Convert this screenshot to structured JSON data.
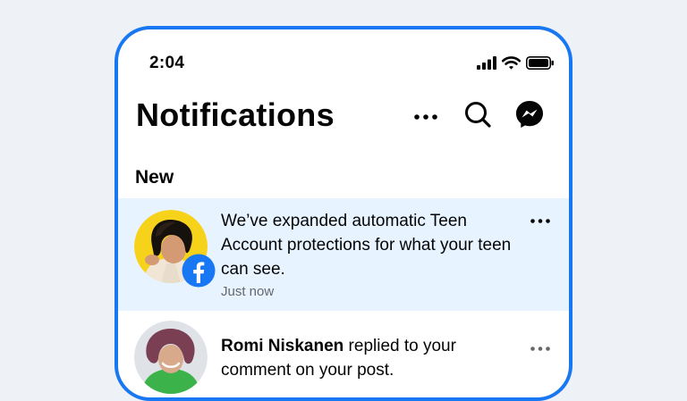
{
  "status_bar": {
    "time": "2:04",
    "icons": [
      "cellular-signal-icon",
      "wifi-icon",
      "battery-icon"
    ]
  },
  "header": {
    "title": "Notifications",
    "actions": [
      "more-options-icon",
      "search-icon",
      "messenger-icon"
    ]
  },
  "sections": {
    "new_label": "New"
  },
  "notifications": [
    {
      "text": "We’ve expanded automatic Teen Account protections for what your teen can see.",
      "time": "Just now",
      "unread": true,
      "badge_icon": "facebook-icon"
    },
    {
      "sender": "Romi Niskanen",
      "text": " replied to your comment on your post.",
      "unread": false
    }
  ],
  "colors": {
    "accent": "#1877f2",
    "unread_background": "#e7f3ff",
    "avatar_1_background": "#f7d21b",
    "secondary_text": "#65676b",
    "page_background": "#eef1f6"
  }
}
